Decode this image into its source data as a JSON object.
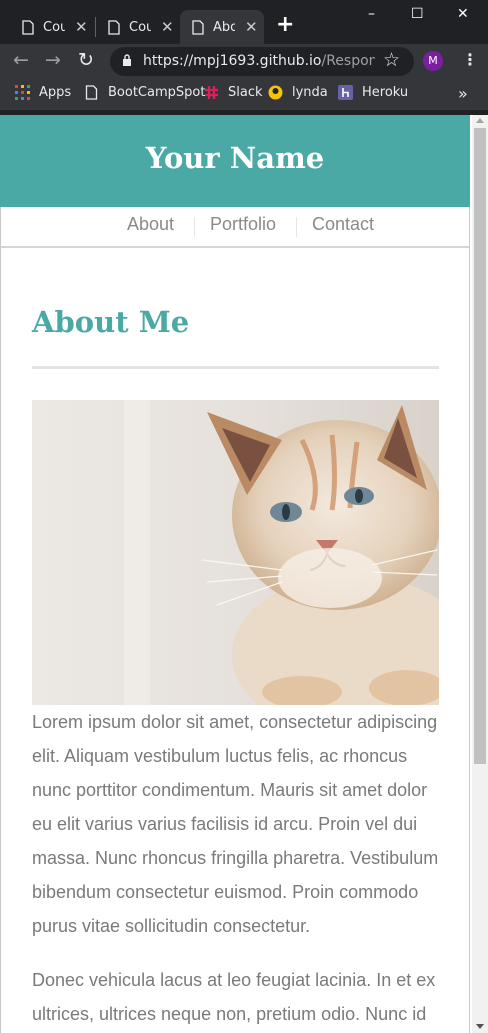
{
  "browser": {
    "tabs": [
      {
        "label": "Cou",
        "active": false
      },
      {
        "label": "Cou",
        "active": false
      },
      {
        "label": "Abo",
        "active": true
      }
    ],
    "new_tab": "+",
    "window_controls": {
      "minimize": "–",
      "maximize": "☐",
      "close": "✕"
    },
    "url_host": "https://mpj1693.github.io",
    "url_path": "/Respons...",
    "profile_initial": "M",
    "bookmarks": [
      "Apps",
      "BootCampSpot",
      "Slack",
      "lynda",
      "Heroku"
    ],
    "overflow": "»"
  },
  "page": {
    "brand": "Your Name",
    "nav": [
      "About",
      "Portfolio",
      "Contact"
    ],
    "heading": "About Me",
    "paragraphs": [
      "Lorem ipsum dolor sit amet, consectetur adipiscing elit. Aliquam vestibulum luctus felis, ac rhoncus nunc porttitor condimentum. Mauris sit amet dolor eu elit varius varius facilisis id arcu. Proin vel dui massa. Nunc rhoncus fringilla pharetra. Vestibulum bibendum consectetur euismod. Proin commodo purus vitae sollicitudin consectetur.",
      "Donec vehicula lacus at leo feugiat lacinia. In et ex ultrices, ultrices neque non, pretium odio. Nunc id"
    ]
  },
  "colors": {
    "accent": "#4aa9a4",
    "chrome_dark": "#202124",
    "chrome": "#35363a",
    "text": "#7a7a7a"
  },
  "icons": [
    "page-icon",
    "close-icon",
    "back-icon",
    "forward-icon",
    "reload-icon",
    "lock-icon",
    "star-icon",
    "menu-icon",
    "apps-icon",
    "slack-icon",
    "lynda-icon",
    "heroku-icon"
  ]
}
